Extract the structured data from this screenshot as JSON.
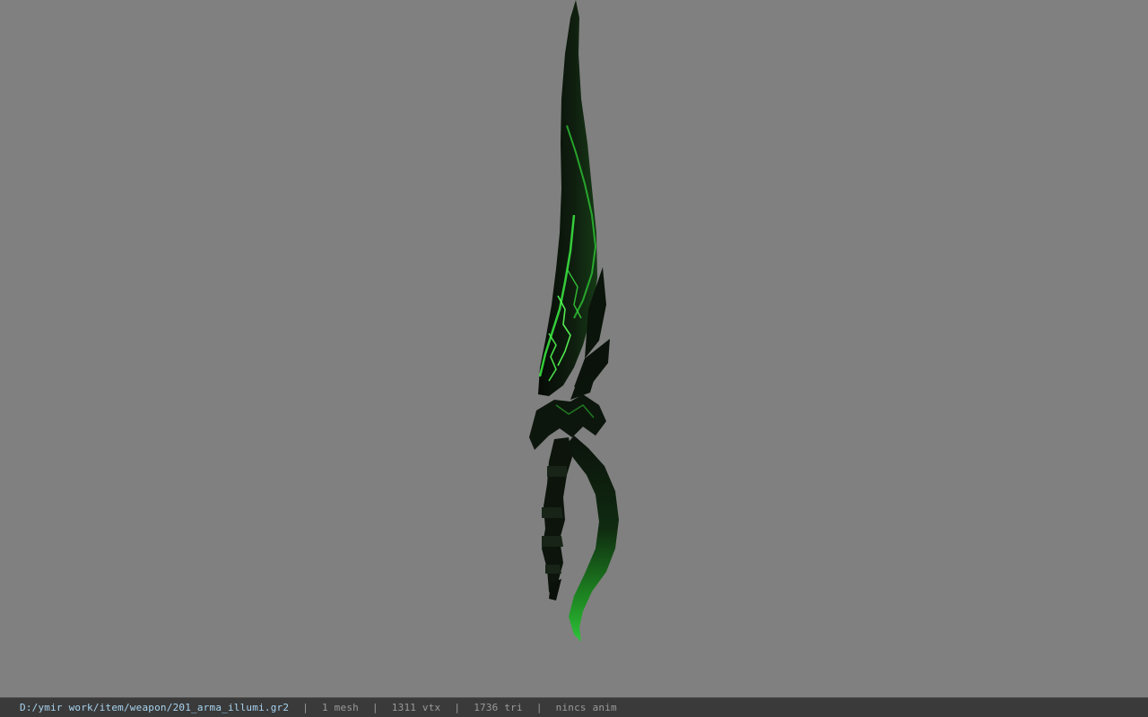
{
  "viewport": {
    "background_color": "#808080",
    "model_colors": {
      "dark": "#0c130c",
      "mid": "#123012",
      "glow": "#2fe03a",
      "bright_glow": "#66ff66"
    }
  },
  "statusbar": {
    "file_path": "D:/ymir work/item/weapon/201_arma_illumi.gr2",
    "separator": "|",
    "mesh_count": "1 mesh",
    "vertex_count": "1311 vtx",
    "triangle_count": "1736 tri",
    "animation": "nincs anim",
    "path_color": "#a8d4f0",
    "text_color": "#9a9a9a",
    "background_color": "#3a3a3a"
  }
}
